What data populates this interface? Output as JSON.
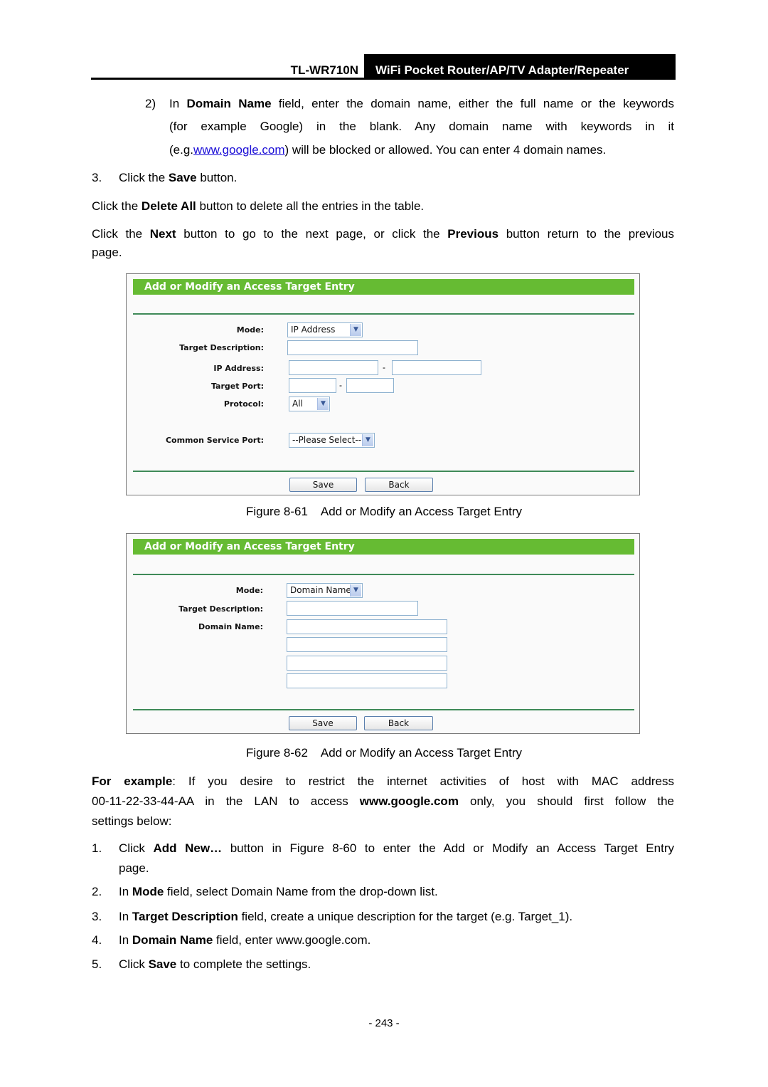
{
  "header": {
    "model": "TL-WR710N",
    "product": "WiFi Pocket Router/AP/TV Adapter/Repeater"
  },
  "step2": {
    "number": "2)",
    "pre": "In ",
    "bold": "Domain Name",
    "line1_rest": " field, enter the domain name, either the full name or the keywords",
    "line2": "(for example Google) in the blank. Any domain name with keywords in it",
    "line3_pre": "(e.g.",
    "link": "www.google.com",
    "line3_post": ") will be blocked or allowed. You can enter 4 domain names."
  },
  "step3": {
    "number": "3.",
    "pre": "Click the ",
    "bold": "Save",
    "post": " button."
  },
  "para_delete": {
    "pre": "Click the ",
    "bold": "Delete All",
    "post": " button to delete all the entries in the table."
  },
  "para_next": {
    "pre": "Click the ",
    "bold1": "Next",
    "mid": " button to go to the next page, or click the ",
    "bold2": "Previous",
    "post": " button return to the previous",
    "line2": "page."
  },
  "figure61": {
    "panel_title": "Add or Modify an Access Target Entry",
    "labels": {
      "mode": "Mode:",
      "target_description": "Target Description:",
      "ip_address": "IP Address:",
      "target_port": "Target Port:",
      "protocol": "Protocol:",
      "common_service_port": "Common Service Port:"
    },
    "mode_value": "IP Address",
    "protocol_value": "All",
    "service_port_value": "--Please Select--",
    "range_separator": "-",
    "save_label": "Save",
    "back_label": "Back",
    "caption": "Figure 8-61    Add or Modify an Access Target Entry"
  },
  "figure62": {
    "panel_title": "Add or Modify an Access Target Entry",
    "labels": {
      "mode": "Mode:",
      "target_description": "Target Description:",
      "domain_name": "Domain Name:"
    },
    "mode_value": "Domain Name",
    "save_label": "Save",
    "back_label": "Back",
    "caption": "Figure 8-62    Add or Modify an Access Target Entry"
  },
  "example": {
    "bold": "For example",
    "line1_rest": ": If you desire to restrict the internet activities of host with MAC address",
    "line2_pre": "00-11-22-33-44-AA in the LAN to access ",
    "line2_bold": "www.google.com",
    "line2_post": " only, you should first follow the",
    "line3": "settings below:"
  },
  "steps": [
    {
      "number": "1.",
      "pre": "Click ",
      "bold": "Add New…",
      "post": " button in Figure 8-60 to enter the Add or Modify an Access Target Entry",
      "line2": "page."
    },
    {
      "number": "2.",
      "pre": "In ",
      "bold": "Mode",
      "post": " field, select Domain Name from the drop-down list."
    },
    {
      "number": "3.",
      "pre": "In ",
      "bold": "Target Description",
      "post": " field, create a unique description for the target (e.g. Target_1)."
    },
    {
      "number": "4.",
      "pre": "In ",
      "bold": "Domain Name",
      "post": " field, enter www.google.com."
    },
    {
      "number": "5.",
      "pre": "Click ",
      "bold": "Save",
      "post": " to complete the settings."
    }
  ],
  "page_number": "- 243 -"
}
